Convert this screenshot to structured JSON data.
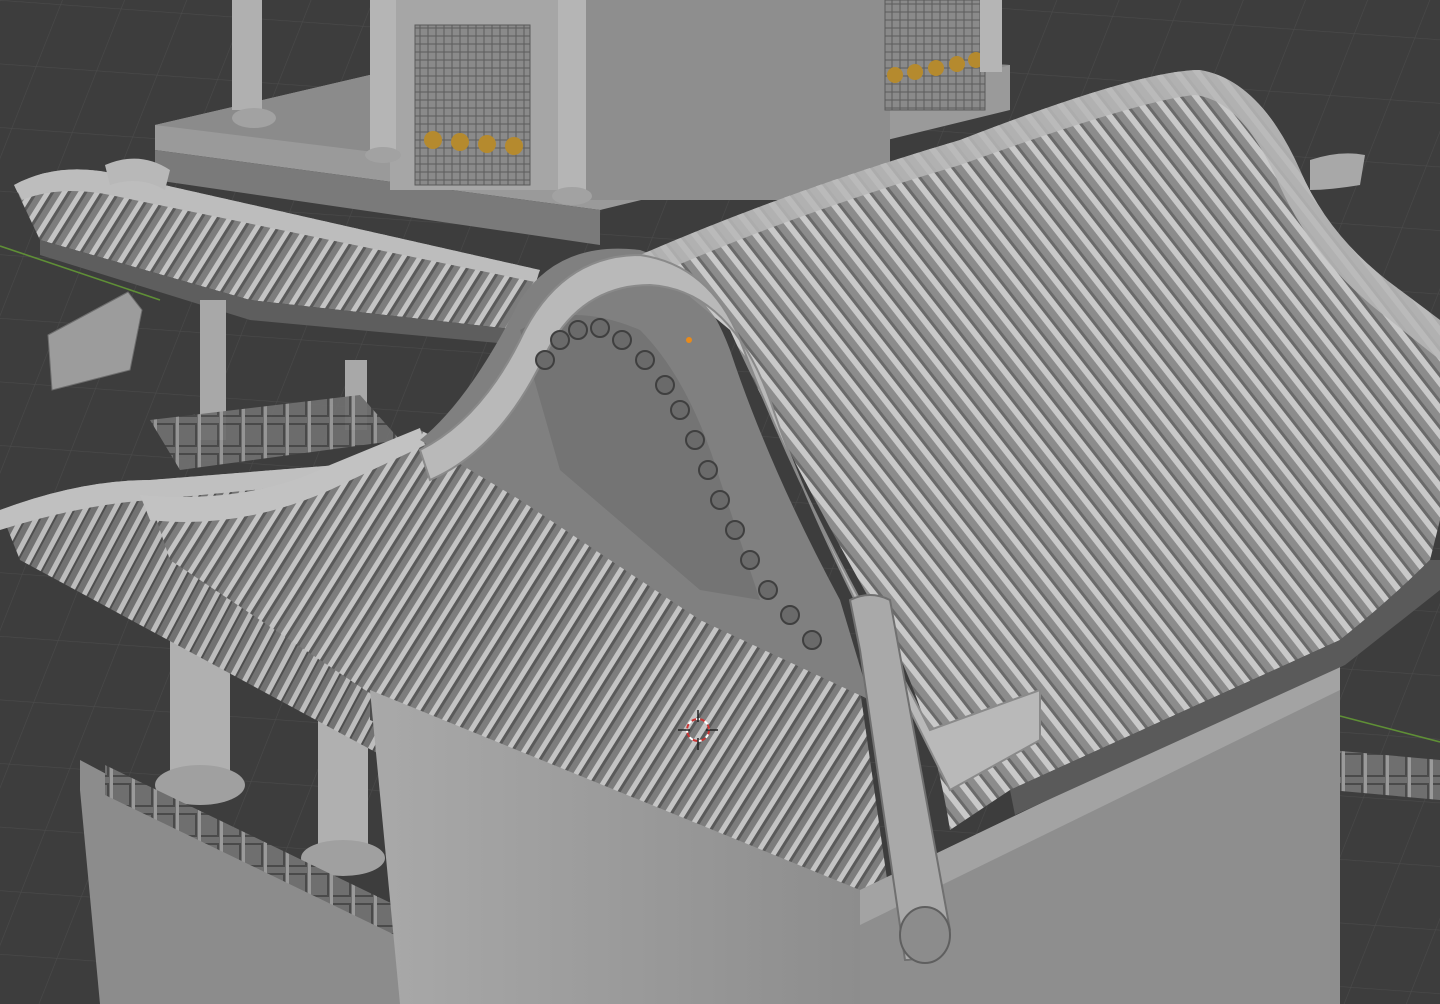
{
  "app": {
    "name": "3D Viewport",
    "scene_description": ""
  },
  "viewport": {
    "background": "#3d3d3d",
    "grid_color": "#4a4a4a",
    "axis_x_color": "#b04848",
    "axis_y_color": "#6a9a3a",
    "model_base": "#8e8e8e",
    "model_light": "#b3b3b3",
    "model_dark": "#5f5f5f",
    "tile_highlight": "#c6c6c6",
    "ornament_gold": "#b58a2e",
    "cursor_red": "#cc3333",
    "origin_orange": "#e88a1a",
    "icons": {
      "cursor": "3d-cursor-icon",
      "origin": "object-origin-icon"
    }
  }
}
